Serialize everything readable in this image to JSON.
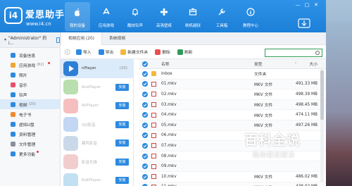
{
  "app": {
    "brand": "爱思助手",
    "url": "www.i4.cn",
    "logo_text": "i4"
  },
  "nav": [
    {
      "label": "我的设备",
      "icon": "apple-icon"
    },
    {
      "label": "应用游戏",
      "icon": "appstore-icon"
    },
    {
      "label": "酷炫铃声",
      "icon": "bell-icon"
    },
    {
      "label": "高清壁纸",
      "icon": "flower-icon"
    },
    {
      "label": "刷机越狱",
      "icon": "box-icon"
    },
    {
      "label": "工具箱",
      "icon": "toolbox-icon"
    },
    {
      "label": "教程中心",
      "icon": "info-icon"
    }
  ],
  "window_controls": [
    "—",
    "□",
    "✕"
  ],
  "sidebar": {
    "device": "\"Administrator\" 的 i...",
    "items": [
      {
        "label": "设备信息",
        "count": "",
        "color": "#2d8ae0",
        "dot": false
      },
      {
        "label": "应用游戏",
        "count": "(62)",
        "color": "#f0a630",
        "dot": true
      },
      {
        "label": "照片",
        "count": "",
        "color": "#2d8ae0",
        "dot": false
      },
      {
        "label": "音乐",
        "count": "",
        "color": "#e84f6a",
        "dot": false
      },
      {
        "label": "铃声",
        "count": "",
        "color": "#2d8ae0",
        "dot": false
      },
      {
        "label": "视频",
        "count": "(20)",
        "color": "#2d8ae0",
        "dot": false,
        "active": true
      },
      {
        "label": "电子书",
        "count": "",
        "color": "#f08a30",
        "dot": false
      },
      {
        "label": "虚拟U盘",
        "count": "",
        "color": "#2d8ae0",
        "dot": false
      },
      {
        "label": "资料管理",
        "count": "",
        "color": "#2d8ae0",
        "dot": false
      },
      {
        "label": "文件管理",
        "count": "",
        "color": "#8a8f99",
        "dot": false
      },
      {
        "label": "更多功能",
        "count": "",
        "color": "#2d8ae0",
        "dot": true
      }
    ]
  },
  "tabs": [
    {
      "label": "视频应用 (20)",
      "active": true
    },
    {
      "label": "系统视频",
      "active": false
    }
  ],
  "toolbar": {
    "buttons": [
      {
        "label": "导入",
        "icon": "import-icon",
        "color": "#2d8ae0",
        "disabled": false
      },
      {
        "label": "导出",
        "icon": "export-icon",
        "color": "#2d8ae0",
        "disabled": false
      },
      {
        "label": "新建文件夹",
        "icon": "new-folder-icon",
        "color": "#f4b73c",
        "disabled": false
      },
      {
        "label": "删除",
        "icon": "delete-icon",
        "color": "#e84f4f",
        "disabled": false
      },
      {
        "label": "刷新",
        "icon": "refresh-icon",
        "color": "#2e9b5a",
        "disabled": false
      }
    ],
    "search_placeholder": ""
  },
  "apps": [
    {
      "name": "nPlayer",
      "count": "(20)",
      "color": "#2f7fd6",
      "installed": true,
      "active": true
    },
    {
      "name": "AcePlayer",
      "color": "#7fc46b",
      "installed": false
    },
    {
      "name": "AVPlayer",
      "color": "#ef8a8a",
      "installed": false
    },
    {
      "name": "QQ影音",
      "color": "#8fb7e8",
      "installed": false
    },
    {
      "name": "暴风影音",
      "color": "#9fb9d8",
      "installed": false
    },
    {
      "name": "影音先锋",
      "color": "#e7a4a4",
      "installed": false
    },
    {
      "name": "KuKPlayer",
      "color": "#8ec7e6",
      "installed": false
    }
  ],
  "install_label": "安装",
  "table": {
    "headers": {
      "name": "名称",
      "type": "类型",
      "size": "大小"
    },
    "rows": [
      {
        "name": "Inbox",
        "type": "文件夹",
        "size": "",
        "folder": true
      },
      {
        "name": "01.mkv",
        "type": "MKV 文件",
        "size": "491.33 MB"
      },
      {
        "name": "02.mkv",
        "type": "MKV 文件",
        "size": "498.39 MB"
      },
      {
        "name": "03.mkv",
        "type": "MKV 文件",
        "size": "498.45 MB"
      },
      {
        "name": "04.mkv",
        "type": "MKV 文件",
        "size": "474.11 MB"
      },
      {
        "name": "05.mkv",
        "type": "MKV 文件",
        "size": "497.26 MB"
      },
      {
        "name": "06.mkv",
        "type": "",
        "size": ""
      },
      {
        "name": "07.mkv",
        "type": "",
        "size": ""
      },
      {
        "name": "08.mkv",
        "type": "",
        "size": ""
      },
      {
        "name": "09.mkv",
        "type": "",
        "size": ""
      },
      {
        "name": "10.mkv",
        "type": "MKV 文件",
        "size": "486.02 MB"
      },
      {
        "name": "11.mkv",
        "type": "MKV 文件",
        "size": "438.02 MB"
      }
    ]
  },
  "watermark": {
    "title": "百科全说",
    "subtitle": "助你轻松解决"
  }
}
